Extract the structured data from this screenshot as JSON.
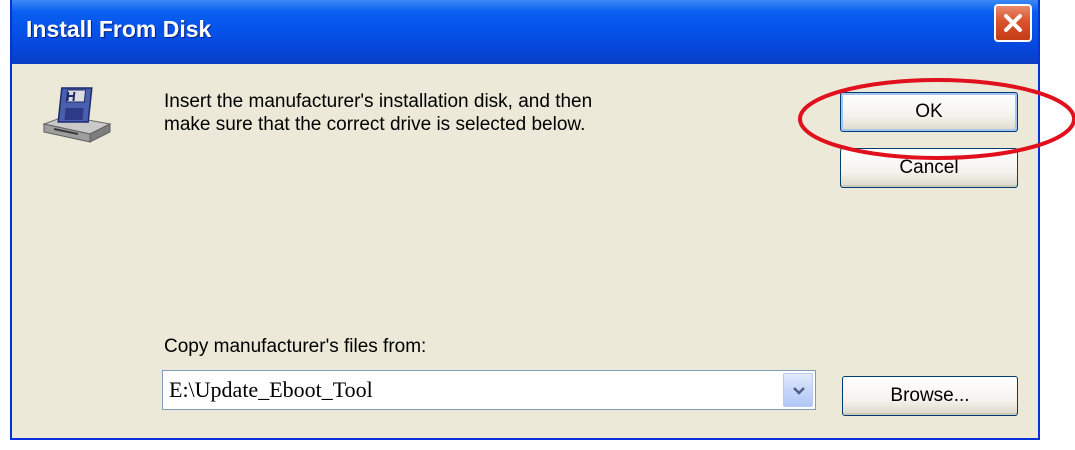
{
  "window": {
    "title": "Install From Disk",
    "close_icon": "close-x-icon"
  },
  "message": {
    "line1": "Insert the manufacturer's installation disk, and then",
    "line2": "make sure that the correct drive is selected below."
  },
  "buttons": {
    "ok": "OK",
    "cancel": "Cancel",
    "browse": "Browse..."
  },
  "copy_from": {
    "label": "Copy manufacturer's files from:",
    "value": "E:\\Update_Eboot_Tool",
    "dropdown_icon": "chevron-down-icon"
  },
  "icons": {
    "disk": "floppy-disk-drive-icon"
  },
  "annotation": {
    "color": "#e0101c",
    "target": "OK"
  },
  "colors": {
    "titlebar": "#0551e8",
    "dialog_bg": "#ece9d8",
    "close_button": "#d9532c"
  }
}
